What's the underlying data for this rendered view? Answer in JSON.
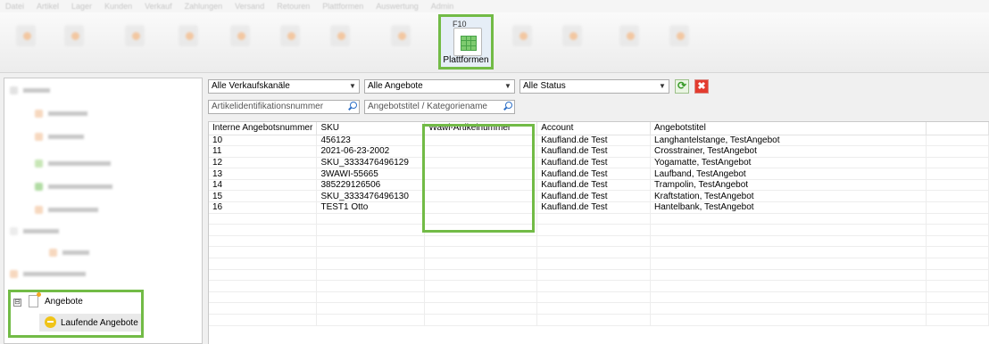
{
  "ribbon": {
    "highlighted_button": {
      "key": "F10",
      "label": "Plattformen"
    },
    "accent_color": "#72bb46"
  },
  "sidebar": {
    "offers_node": {
      "label": "Angebote",
      "expander": "⊟"
    },
    "running_offers": {
      "label": "Laufende Angebote"
    }
  },
  "filters": {
    "channel": "Alle Verkaufskanäle",
    "offers": "Alle Angebote",
    "status": "Alle Status",
    "article_search_placeholder": "Artikelidentifikationsnummer",
    "title_search_placeholder": "Angebotstitel / Kategoriename"
  },
  "table": {
    "columns": [
      "Interne Angebotsnummer",
      "SKU",
      "Wawi-Artikelnummer",
      "Account",
      "Angebotstitel"
    ],
    "rows": [
      [
        "10",
        "456123",
        "",
        "Kaufland.de Test",
        "Langhantelstange, TestAngebot"
      ],
      [
        "11",
        "2021-06-23-2002",
        "",
        "Kaufland.de Test",
        "Crosstrainer, TestAngebot"
      ],
      [
        "12",
        "SKU_3333476496129",
        "",
        "Kaufland.de Test",
        "Yogamatte, TestAngebot"
      ],
      [
        "13",
        "3WAWI-55665",
        "",
        "Kaufland.de Test",
        "Laufband, TestAngebot"
      ],
      [
        "14",
        "385229126506",
        "",
        "Kaufland.de Test",
        "Trampolin, TestAngebot"
      ],
      [
        "15",
        "SKU_3333476496130",
        "",
        "Kaufland.de Test",
        "Kraftstation, TestAngebot"
      ],
      [
        "16",
        "TEST1 Otto",
        "",
        "Kaufland.de Test",
        "Hantelbank, TestAngebot"
      ]
    ]
  }
}
